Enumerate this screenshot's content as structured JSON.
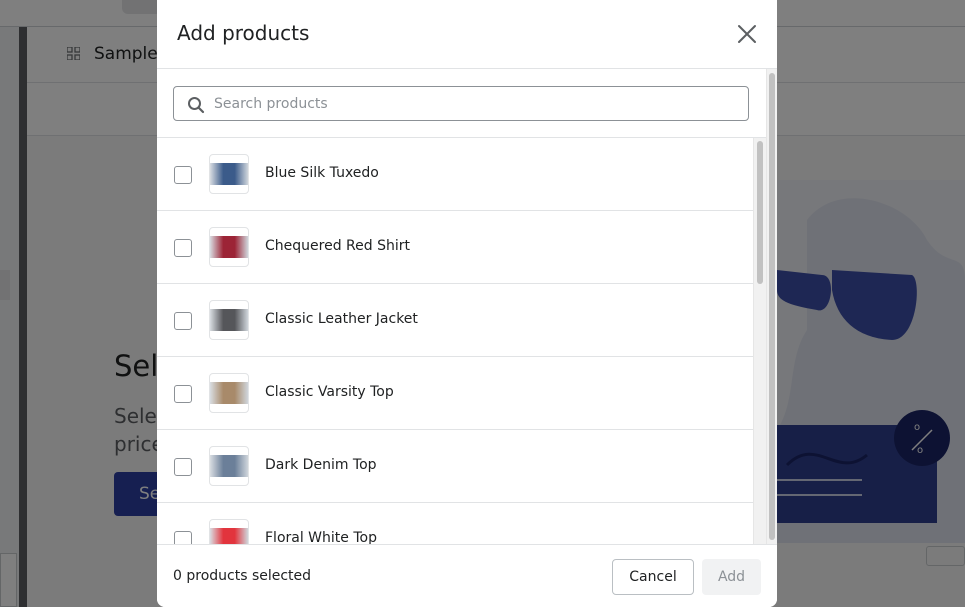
{
  "background": {
    "nav_label": "Sample",
    "heading": "Sele",
    "description": "Sele price",
    "cta_label": "Se",
    "nav_icon": "apps-grid-icon"
  },
  "modal": {
    "title": "Add products",
    "close_icon": "close-icon",
    "search": {
      "placeholder": "Search products",
      "value": "",
      "icon": "search-icon"
    },
    "products": [
      {
        "name": "Blue Silk Tuxedo",
        "checked": false,
        "thumb_color": "#3b5b8a"
      },
      {
        "name": "Chequered Red Shirt",
        "checked": false,
        "thumb_color": "#9c2436"
      },
      {
        "name": "Classic Leather Jacket",
        "checked": false,
        "thumb_color": "#55565a"
      },
      {
        "name": "Classic Varsity Top",
        "checked": false,
        "thumb_color": "#a88a6a"
      },
      {
        "name": "Dark Denim Top",
        "checked": false,
        "thumb_color": "#6b7f99"
      },
      {
        "name": "Floral White Top",
        "checked": false,
        "thumb_color": "#e2343d"
      }
    ],
    "footer": {
      "selected_text": "0 products selected",
      "cancel_label": "Cancel",
      "add_label": "Add",
      "add_disabled": true
    }
  }
}
